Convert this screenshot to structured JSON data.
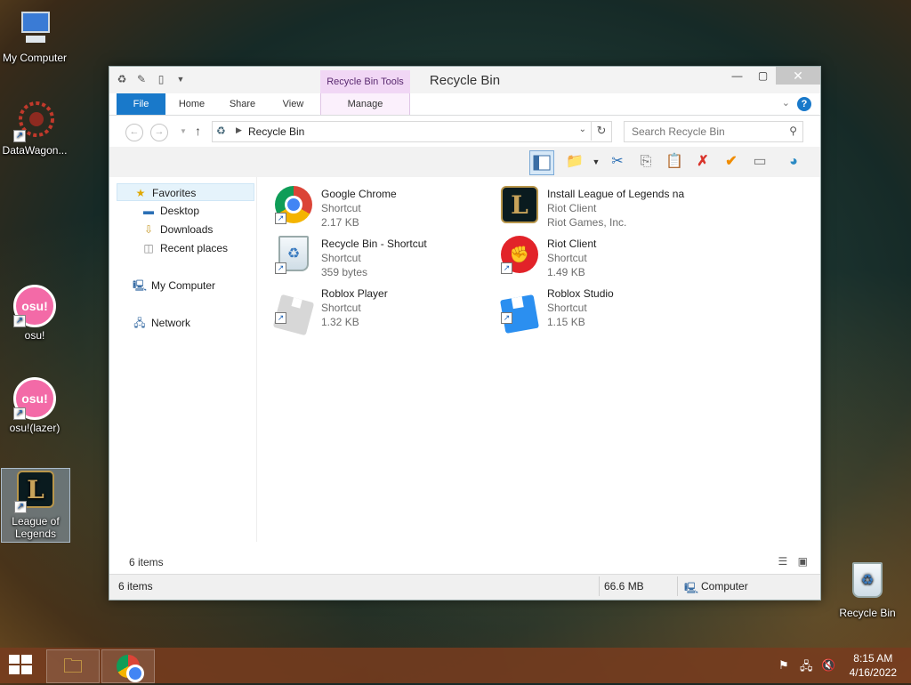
{
  "desktop": {
    "icons": [
      {
        "label": "My Computer"
      },
      {
        "label": "DataWagon..."
      },
      {
        "label": "osu!"
      },
      {
        "label": "osu!(lazer)"
      },
      {
        "label": "League of Legends"
      },
      {
        "label": "Recycle Bin"
      }
    ]
  },
  "window": {
    "title": "Recycle Bin",
    "context_tab": "Recycle Bin Tools",
    "tabs": [
      "File",
      "Home",
      "Share",
      "View",
      "Manage"
    ],
    "address_path": "Recycle Bin",
    "search_placeholder": "Search Recycle Bin",
    "nav": {
      "favorites": "Favorites",
      "desktop": "Desktop",
      "downloads": "Downloads",
      "recent": "Recent places",
      "computer": "My Computer",
      "network": "Network"
    },
    "items": [
      {
        "name": "Google Chrome",
        "type": "Shortcut",
        "detail": "2.17 KB",
        "icon": "chrome-icon"
      },
      {
        "name": "Install League of Legends na",
        "type": "Riot Client",
        "detail": "Riot Games, Inc.",
        "icon": "league-icon"
      },
      {
        "name": "Recycle Bin - Shortcut",
        "type": "Shortcut",
        "detail": "359 bytes",
        "icon": "recycle-bin-icon"
      },
      {
        "name": "Riot Client",
        "type": "Shortcut",
        "detail": "1.49 KB",
        "icon": "riot-icon"
      },
      {
        "name": "Roblox Player",
        "type": "Shortcut",
        "detail": "1.32 KB",
        "icon": "roblox-icon"
      },
      {
        "name": "Roblox Studio",
        "type": "Shortcut",
        "detail": "1.15 KB",
        "icon": "roblox-studio-icon"
      }
    ],
    "item_count": "6 items",
    "status": {
      "count": "6 items",
      "size": "66.6 MB",
      "location": "Computer"
    }
  },
  "taskbar": {
    "time": "8:15 AM",
    "date": "4/16/2022"
  },
  "colors": {
    "accent": "#1979ca",
    "context_tab": "#f1d7f5"
  }
}
